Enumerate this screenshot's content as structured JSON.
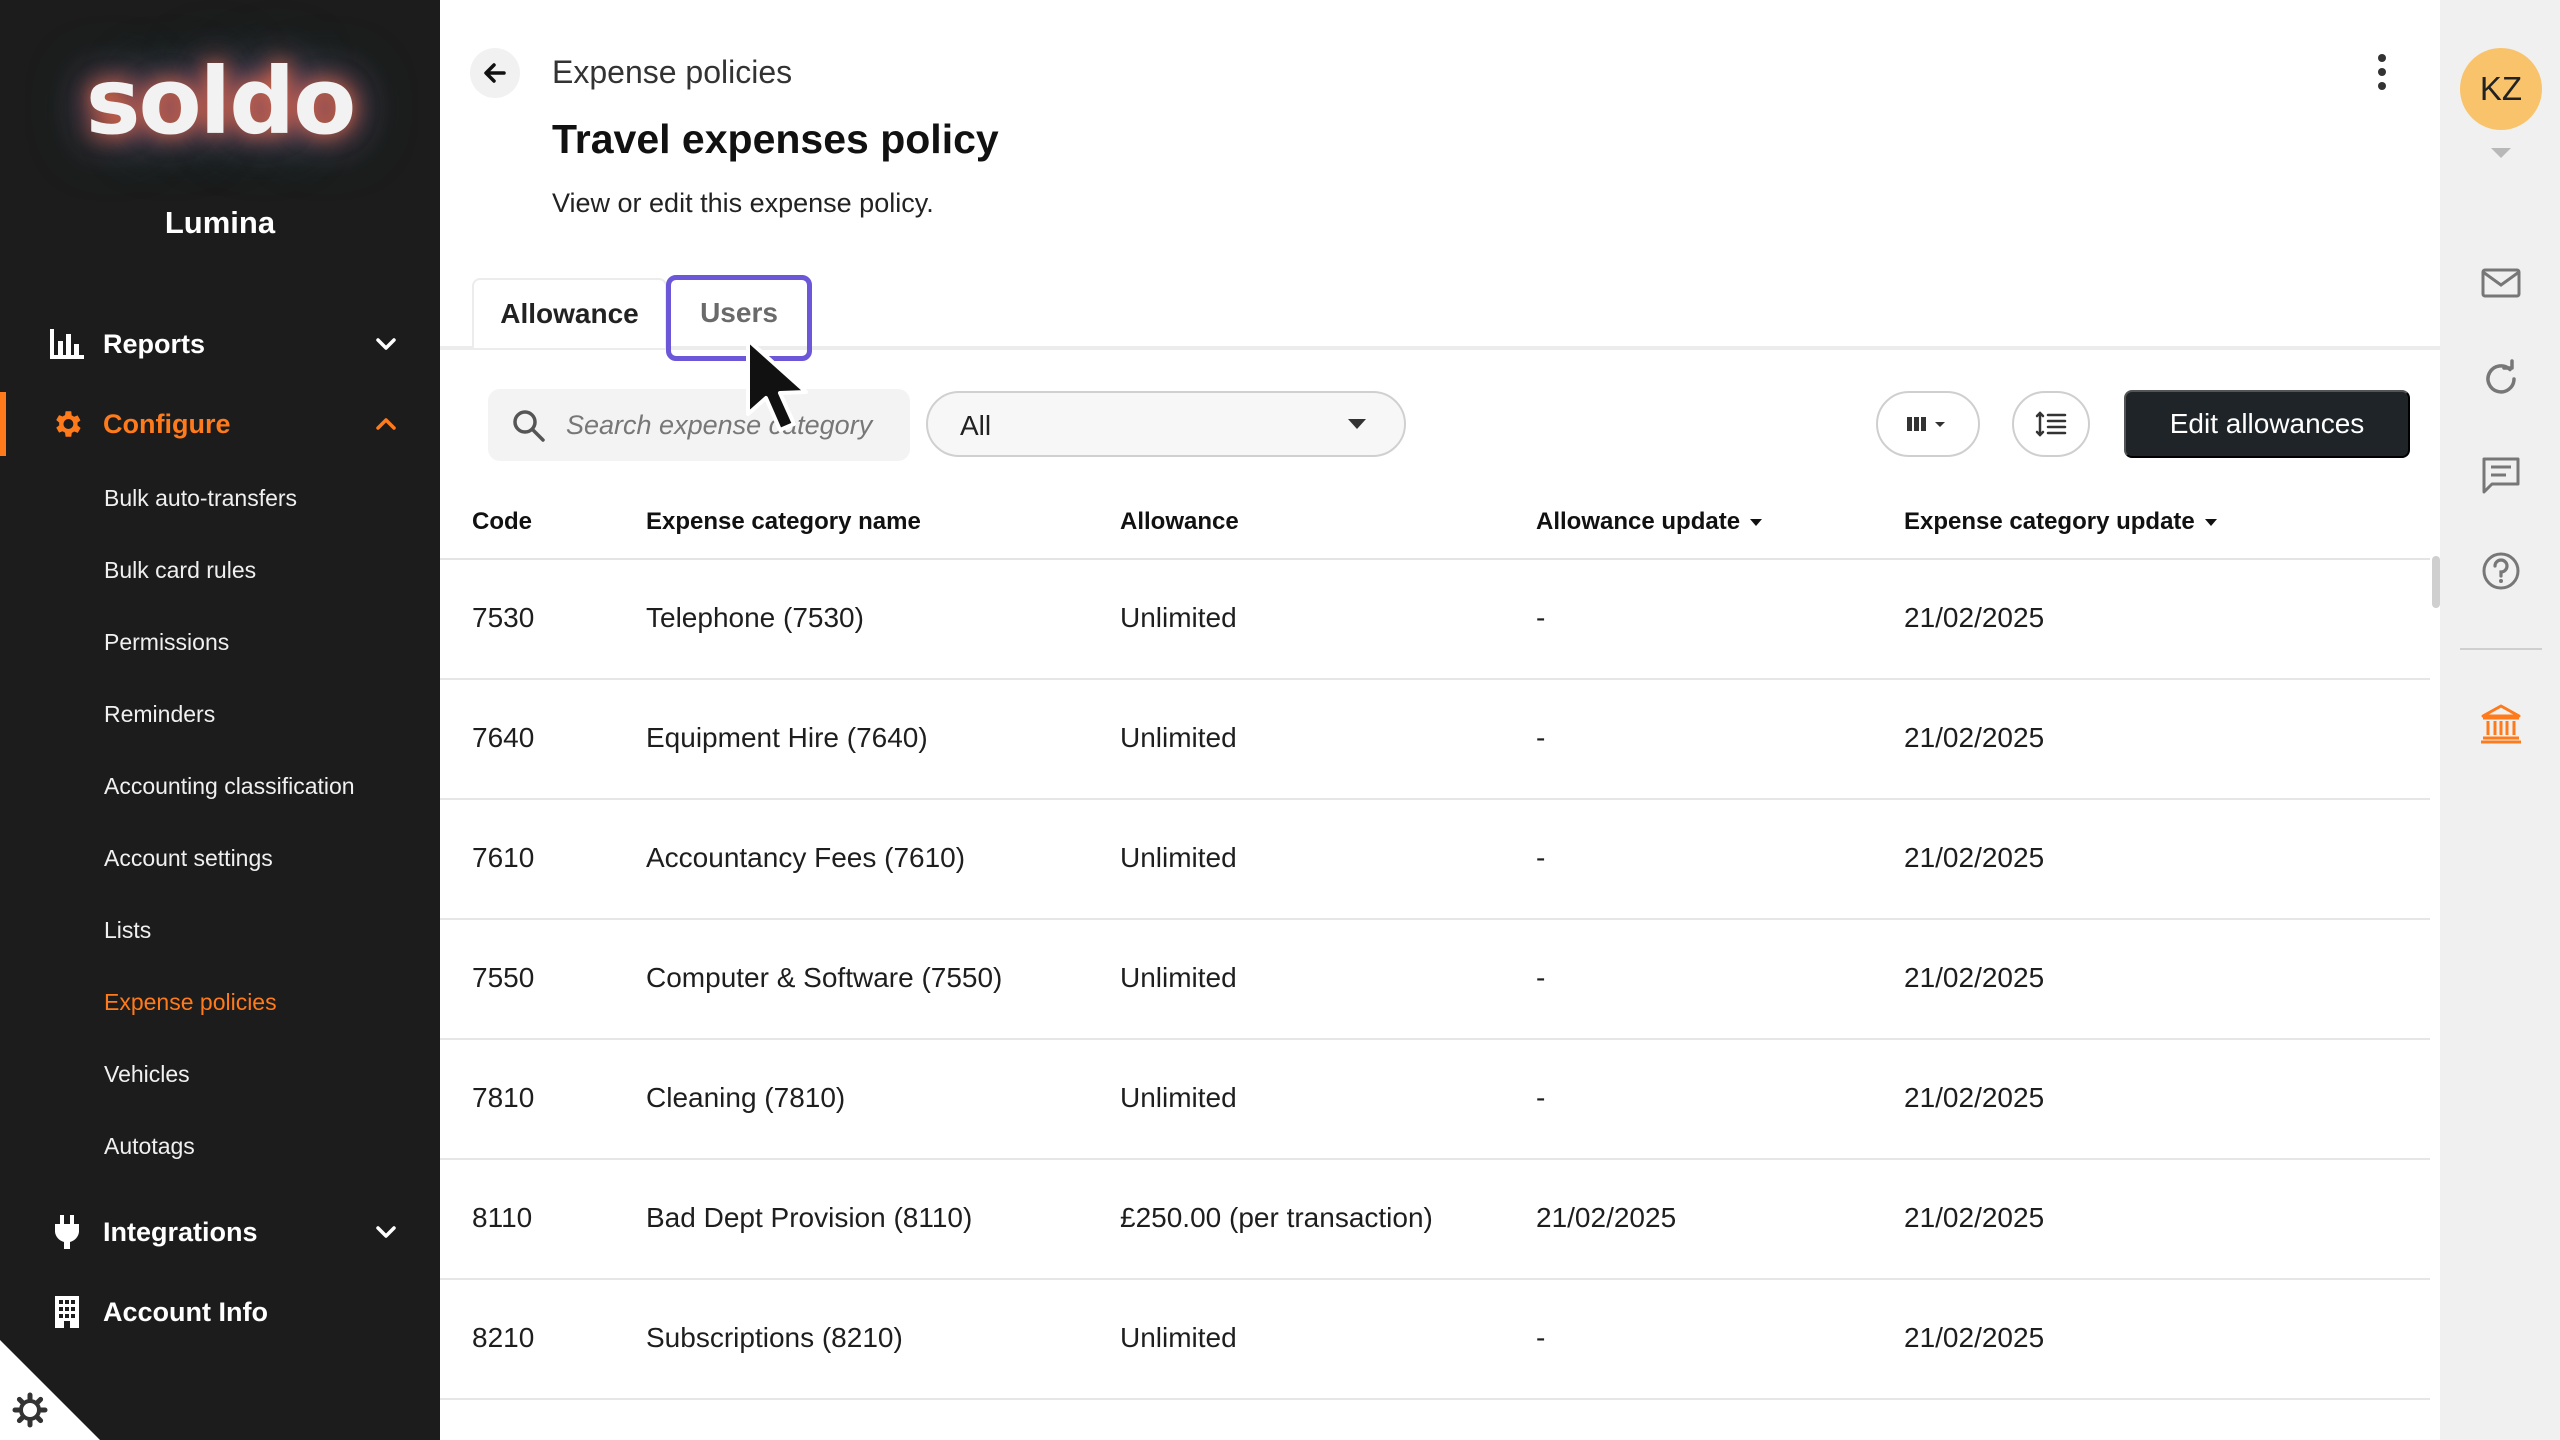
{
  "sidebar": {
    "logo_text": "soldo",
    "org_name": "Lumina",
    "nav": {
      "reports": "Reports",
      "configure": "Configure",
      "integrations": "Integrations",
      "account_info": "Account Info"
    },
    "configure_items": [
      "Bulk auto-transfers",
      "Bulk card rules",
      "Permissions",
      "Reminders",
      "Accounting classification",
      "Account settings",
      "Lists",
      "Expense policies",
      "Vehicles",
      "Autotags"
    ],
    "current_item": "Expense policies",
    "accent_color": "#ff7a1a"
  },
  "header": {
    "breadcrumb": "Expense policies",
    "title": "Travel expenses policy",
    "subtitle": "View or edit this expense policy."
  },
  "tabs": [
    {
      "label": "Allowance",
      "selected": true
    },
    {
      "label": "Users",
      "selected": false
    }
  ],
  "toolbar": {
    "search_placeholder": "Search expense category",
    "filter_value": "All",
    "edit_label": "Edit allowances"
  },
  "table": {
    "headers": {
      "code": "Code",
      "name": "Expense category name",
      "allowance": "Allowance",
      "allowance_update": "Allowance update",
      "category_update": "Expense category update"
    },
    "rows": [
      {
        "code": "7530",
        "name": "Telephone (7530)",
        "allowance": "Unlimited",
        "allowance_update": "-",
        "category_update": "21/02/2025"
      },
      {
        "code": "7640",
        "name": "Equipment Hire (7640)",
        "allowance": "Unlimited",
        "allowance_update": "-",
        "category_update": "21/02/2025"
      },
      {
        "code": "7610",
        "name": "Accountancy Fees (7610)",
        "allowance": "Unlimited",
        "allowance_update": "-",
        "category_update": "21/02/2025"
      },
      {
        "code": "7550",
        "name": "Computer & Software (7550)",
        "allowance": "Unlimited",
        "allowance_update": "-",
        "category_update": "21/02/2025"
      },
      {
        "code": "7810",
        "name": "Cleaning (7810)",
        "allowance": "Unlimited",
        "allowance_update": "-",
        "category_update": "21/02/2025"
      },
      {
        "code": "8110",
        "name": "Bad Dept Provision (8110)",
        "allowance": "£250.00 (per transaction)",
        "allowance_update": "21/02/2025",
        "category_update": "21/02/2025"
      },
      {
        "code": "8210",
        "name": "Subscriptions (8210)",
        "allowance": "Unlimited",
        "allowance_update": "-",
        "category_update": "21/02/2025"
      }
    ]
  },
  "user": {
    "initials": "KZ",
    "avatar_color": "#f9c36b"
  },
  "rail_icons": [
    "mail-icon",
    "refresh-icon",
    "chat-icon",
    "help-icon",
    "bank-icon"
  ]
}
